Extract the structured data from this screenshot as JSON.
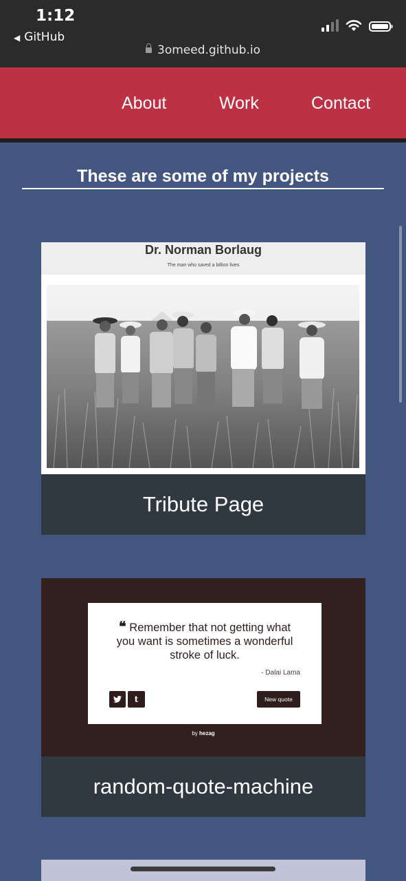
{
  "status_bar": {
    "time": "1:12",
    "back_app": "GitHub",
    "url": "3omeed.github.io"
  },
  "nav": {
    "links": [
      "About",
      "Work",
      "Contact"
    ]
  },
  "projects_section": {
    "title": "These are some of my projects"
  },
  "projects": [
    {
      "caption": "Tribute Page",
      "preview_title": "Dr. Norman Borlaug",
      "preview_subtitle": "The man who saved a billion lives"
    },
    {
      "caption": "random-quote-machine",
      "quote": "Remember that not getting what you want is sometimes a wonderful stroke of luck.",
      "author": "- Dalai Lama",
      "new_quote_label": "New quote",
      "twitter_glyph": "t",
      "tumblr_glyph": "t",
      "credit_prefix": "by ",
      "credit_name": "hezag"
    }
  ],
  "colors": {
    "page_bg": "#425680",
    "nav_bg": "#be3144",
    "caption_bg": "#303841",
    "quote_bg": "#32201f"
  }
}
